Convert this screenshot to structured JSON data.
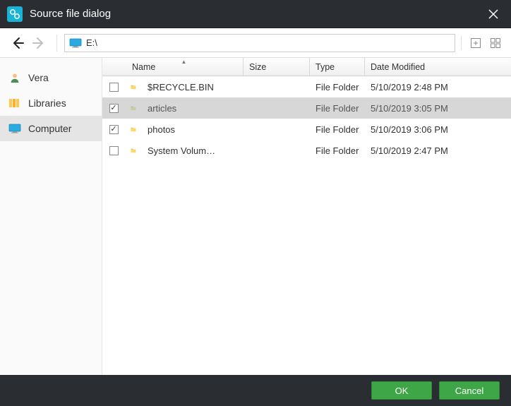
{
  "title": "Source file dialog",
  "path": "E:\\",
  "sidebar": {
    "items": [
      {
        "label": "Vera",
        "icon": "user",
        "active": false
      },
      {
        "label": "Libraries",
        "icon": "library",
        "active": false
      },
      {
        "label": "Computer",
        "icon": "monitor",
        "active": true
      }
    ]
  },
  "columns": {
    "name": "Name",
    "size": "Size",
    "type": "Type",
    "date": "Date Modified",
    "sorted": "name",
    "sort_dir": "asc"
  },
  "rows": [
    {
      "checked": false,
      "name": "$RECYCLE.BIN",
      "size": "",
      "type": "File Folder",
      "date": "5/10/2019 2:48 PM",
      "selected": false
    },
    {
      "checked": true,
      "name": "articles",
      "size": "",
      "type": "File Folder",
      "date": "5/10/2019 3:05 PM",
      "selected": true
    },
    {
      "checked": true,
      "name": "photos",
      "size": "",
      "type": "File Folder",
      "date": "5/10/2019 3:06 PM",
      "selected": false
    },
    {
      "checked": false,
      "name": "System Volum…",
      "size": "",
      "type": "File Folder",
      "date": "5/10/2019 2:47 PM",
      "selected": false
    }
  ],
  "buttons": {
    "ok": "OK",
    "cancel": "Cancel"
  },
  "nav": {
    "back_enabled": true,
    "forward_enabled": false
  }
}
